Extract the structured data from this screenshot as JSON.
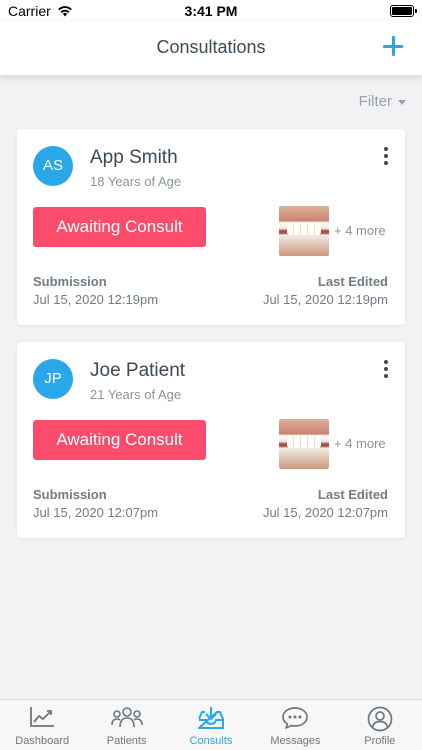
{
  "status_bar": {
    "carrier": "Carrier",
    "time": "3:41 PM"
  },
  "header": {
    "title": "Consultations",
    "add_icon": "plus-icon"
  },
  "filter": {
    "label": "Filter"
  },
  "consults": [
    {
      "initials": "AS",
      "name": "App Smith",
      "age": "18 Years of Age",
      "status": "Awaiting Consult",
      "more_photos": "+ 4 more",
      "submission_label": "Submission",
      "submission_date": "Jul 15, 2020 12:19pm",
      "edited_label": "Last Edited",
      "edited_date": "Jul 15, 2020 12:19pm"
    },
    {
      "initials": "JP",
      "name": "Joe Patient",
      "age": "21 Years of Age",
      "status": "Awaiting Consult",
      "more_photos": "+ 4 more",
      "submission_label": "Submission",
      "submission_date": "Jul 15, 2020 12:07pm",
      "edited_label": "Last Edited",
      "edited_date": "Jul 15, 2020 12:07pm"
    }
  ],
  "tabs": [
    {
      "label": "Dashboard",
      "icon": "chart-icon",
      "active": false
    },
    {
      "label": "Patients",
      "icon": "people-icon",
      "active": false
    },
    {
      "label": "Consults",
      "icon": "inbox-download-icon",
      "active": true
    },
    {
      "label": "Messages",
      "icon": "chat-icon",
      "active": false
    },
    {
      "label": "Profile",
      "icon": "profile-icon",
      "active": false
    }
  ],
  "colors": {
    "accent": "#2aa7e8",
    "status": "#fb4d6b",
    "background": "#f2f2f4"
  }
}
